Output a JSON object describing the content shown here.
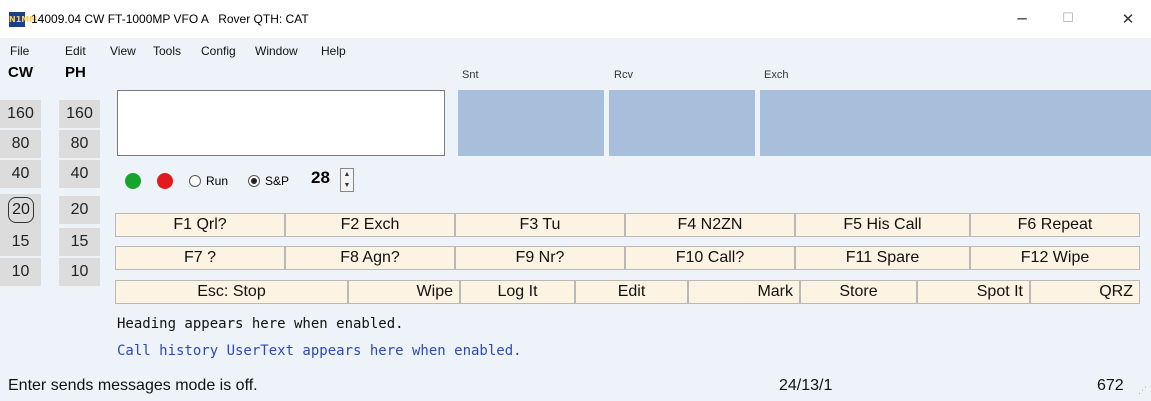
{
  "window": {
    "title": "14009.04 CW FT-1000MP VFO A   Rover QTH: CAT",
    "icon": "N1MM",
    "minimize": "─",
    "maximize": "☐",
    "close": "✕"
  },
  "menu": [
    "File",
    "Edit",
    "View",
    "Tools",
    "Config",
    "Window",
    "Help"
  ],
  "bands": {
    "cw_label": "CW",
    "ph_label": "PH",
    "cw": [
      "160",
      "80",
      "40",
      "20",
      "15",
      "10"
    ],
    "ph": [
      "160",
      "80",
      "40",
      "20",
      "15",
      "10"
    ],
    "selected_cw": "20"
  },
  "entry": {
    "call_value": "",
    "snt_label": "Snt",
    "rcv_label": "Rcv",
    "exch_label": "Exch",
    "snt_value": "",
    "rcv_value": "",
    "exch_value": ""
  },
  "mode": {
    "run_label": "Run",
    "sp_label": "S&P",
    "selected": "S&P",
    "power": "28",
    "green_color": "#16a52b",
    "red_color": "#e11a1a"
  },
  "fkeys_row1": [
    "F1 Qrl?",
    "F2 Exch",
    "F3 Tu",
    "F4 N2ZN",
    "F5 His Call",
    "F6 Repeat"
  ],
  "fkeys_row2": [
    "F7 ?",
    "F8 Agn?",
    "F9 Nr?",
    "F10 Call?",
    "F11 Spare",
    "F12 Wipe"
  ],
  "buttons_row3": [
    "Esc: Stop",
    "Wipe",
    "Log It",
    "Edit",
    "Mark",
    "Store",
    "Spot It",
    "QRZ"
  ],
  "info": {
    "heading": "Heading appears here when enabled.",
    "call_history": "Call history UserText appears here when enabled.",
    "call_history_color": "#2a4ab8"
  },
  "status": {
    "message": "Enter sends messages mode is off.",
    "counts": "24/13/1",
    "number": "672"
  }
}
